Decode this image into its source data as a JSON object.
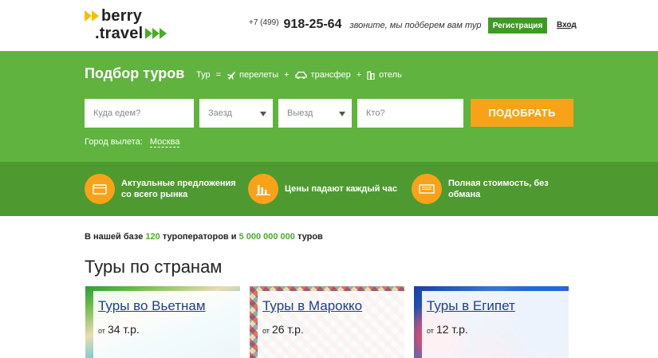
{
  "header": {
    "logo_top": "berry",
    "logo_bottom": ".travel",
    "phone_code": "+7 (499)",
    "phone_number": "918-25-64",
    "phone_note": "звоните, мы подберем вам тур",
    "register_label": "Регистрация",
    "login_label": "Вход"
  },
  "colors": {
    "brand_green": "#5fb33e",
    "dark_green": "#4e9a30",
    "accent_orange": "#f8a21a",
    "logo_yellow": "#f5c000"
  },
  "search": {
    "title": "Подбор туров",
    "formula": {
      "tour": "Тур",
      "eq": "=",
      "plus": "+",
      "flights": "перелеты",
      "transfer": "трансфер",
      "hotel": "отель",
      "flights_icon": "plane-icon",
      "transfer_icon": "car-icon",
      "hotel_icon": "building-icon"
    },
    "destination_placeholder": "Куда едем?",
    "checkin_placeholder": "Заезд",
    "checkout_placeholder": "Выезд",
    "who_placeholder": "Кто?",
    "submit_label": "ПОДОБРАТЬ",
    "departure_label": "Город вылета:",
    "departure_city": "Москва"
  },
  "features": [
    {
      "text": "Актуальные предложения со всего рынка",
      "icon": "card-icon"
    },
    {
      "text": "Цены падают каждый час",
      "icon": "bar-chart-icon"
    },
    {
      "text": "Полная стоимость, без обмана",
      "icon": "ticket-icon"
    }
  ],
  "stats": {
    "prefix": "В нашей базе",
    "operators_count": "120",
    "middle": "туроператоров и",
    "tours_count": "5 000 000 000",
    "suffix": "туров"
  },
  "countries": {
    "title": "Туры по странам",
    "items": [
      {
        "title": "Туры во Вьетнам",
        "from": "от",
        "price": "34 т.р."
      },
      {
        "title": "Туры в Марокко",
        "from": "от",
        "price": "26 т.р."
      },
      {
        "title": "Туры в Египет",
        "from": "от",
        "price": "12 т.р."
      }
    ]
  }
}
